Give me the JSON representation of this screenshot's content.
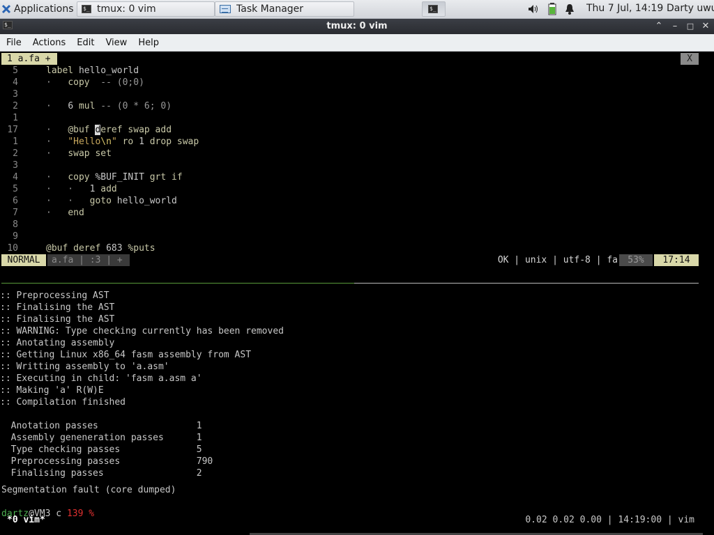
{
  "panel": {
    "apps_label": "Applications",
    "tasks": [
      {
        "label": "tmux: 0 vim",
        "icon": "terminal-icon"
      },
      {
        "label": "Task Manager",
        "icon": "task-manager-icon"
      }
    ],
    "clock": "Thu  7 Jul, 14:19",
    "user": "Darty uwu"
  },
  "window": {
    "title": "tmux: 0 vim",
    "menu": [
      "File",
      "Actions",
      "Edit",
      "View",
      "Help"
    ]
  },
  "vim": {
    "tab_label": "1 a.fa +",
    "tab_close": "X",
    "lines": [
      {
        "n": "5",
        "segs": [
          {
            "t": "label ",
            "c": "k"
          },
          {
            "t": "hello_world",
            "c": ""
          }
        ]
      },
      {
        "n": "4",
        "segs": [
          {
            "t": "·   ",
            "c": "cm"
          },
          {
            "t": "copy  ",
            "c": "k"
          },
          {
            "t": "-- (0;0)",
            "c": "cm"
          }
        ]
      },
      {
        "n": "3",
        "segs": []
      },
      {
        "n": "2",
        "segs": [
          {
            "t": "·   ",
            "c": "cm"
          },
          {
            "t": "6 ",
            "c": ""
          },
          {
            "t": "mul ",
            "c": "k"
          },
          {
            "t": "-- (0 * 6; 0)",
            "c": "cm"
          }
        ]
      },
      {
        "n": "1",
        "segs": []
      },
      {
        "n": "17",
        "segs": [
          {
            "t": "·   ",
            "c": "cm"
          },
          {
            "t": "@buf ",
            "c": "k"
          },
          {
            "t": "d",
            "c": "cur"
          },
          {
            "t": "eref swap add",
            "c": "k"
          }
        ]
      },
      {
        "n": "1",
        "segs": [
          {
            "t": "·   ",
            "c": "cm"
          },
          {
            "t": "\"Hello",
            "c": "st"
          },
          {
            "t": "\\n",
            "c": "yl"
          },
          {
            "t": "\" ",
            "c": "st"
          },
          {
            "t": "ro ",
            "c": "k"
          },
          {
            "t": "1 ",
            "c": ""
          },
          {
            "t": "drop swap",
            "c": "k"
          }
        ]
      },
      {
        "n": "2",
        "segs": [
          {
            "t": "·   ",
            "c": "cm"
          },
          {
            "t": "swap set",
            "c": "k"
          }
        ]
      },
      {
        "n": "3",
        "segs": []
      },
      {
        "n": "4",
        "segs": [
          {
            "t": "·   ",
            "c": "cm"
          },
          {
            "t": "copy ",
            "c": "k"
          },
          {
            "t": "%BUF_INIT ",
            "c": ""
          },
          {
            "t": "grt if",
            "c": "k"
          }
        ]
      },
      {
        "n": "5",
        "segs": [
          {
            "t": "·   ·   ",
            "c": "cm"
          },
          {
            "t": "1 ",
            "c": ""
          },
          {
            "t": "add",
            "c": "k"
          }
        ]
      },
      {
        "n": "6",
        "segs": [
          {
            "t": "·   ·   ",
            "c": "cm"
          },
          {
            "t": "goto ",
            "c": "k"
          },
          {
            "t": "hello_world",
            "c": ""
          }
        ]
      },
      {
        "n": "7",
        "segs": [
          {
            "t": "·   ",
            "c": "cm"
          },
          {
            "t": "end",
            "c": "k"
          }
        ]
      },
      {
        "n": "8",
        "segs": []
      },
      {
        "n": "9",
        "segs": []
      },
      {
        "n": "10",
        "segs": [
          {
            "t": "@buf ",
            "c": "k"
          },
          {
            "t": "deref ",
            "c": "k"
          },
          {
            "t": "683 ",
            "c": ""
          },
          {
            "t": "%puts",
            "c": "k"
          }
        ]
      }
    ],
    "status": {
      "mode": "NORMAL",
      "file": "a.fa | :3 | +",
      "info": "OK | unix | utf-8 | fa",
      "percent": "53%",
      "position": "17:14"
    }
  },
  "shell": {
    "output": [
      ":: Preprocessing AST",
      ":: Finalising the AST",
      ":: Finalising the AST",
      ":: WARNING: Type checking currently has been removed",
      ":: Anotating assembly",
      ":: Getting Linux x86_64 fasm assembly from AST",
      ":: Writting assembly to 'a.asm'",
      ":: Executing in child: 'fasm a.asm a'",
      ":: Making 'a' R(W)E",
      ":: Compilation finished",
      "",
      "  Anotation passes                  1",
      "  Assembly geneneration passes      1",
      "  Type checking passes              5",
      "  Preprocessing passes              790",
      "  Finalising passes                 2"
    ],
    "segfault": "Segmentation fault (core dumped)",
    "prompt_user": "dartz",
    "prompt_host": "@VM3 c ",
    "prompt_code": "139 %",
    "tmux_window": "*0 vim*",
    "tmux_right": "0.02 0.02 0.00 | 14:19:00 | vim"
  },
  "colors": {
    "accent": "#d9d8a9",
    "error_code": "#e03030",
    "prompt_user": "#4caf50"
  }
}
